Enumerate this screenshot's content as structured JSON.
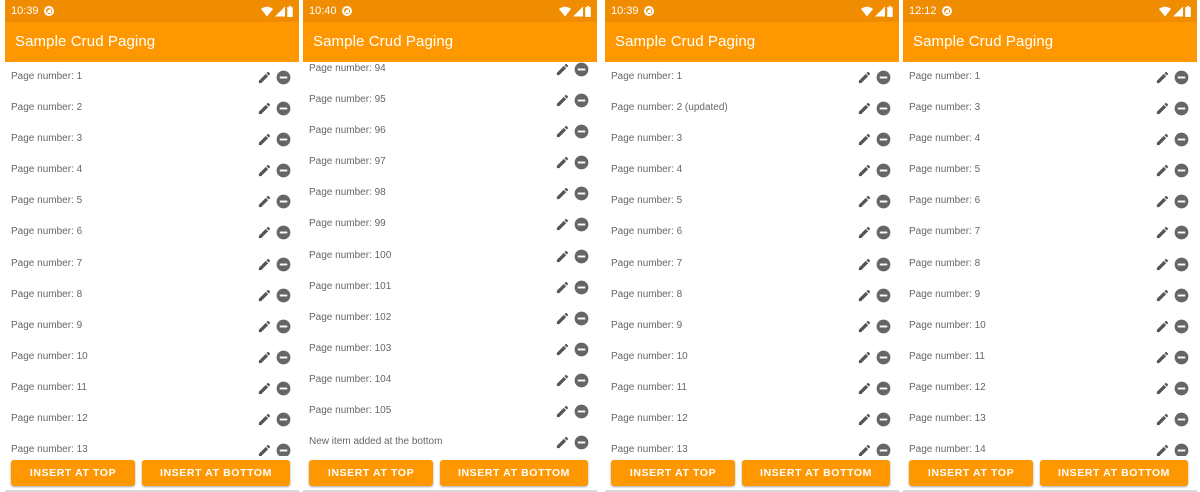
{
  "theme": {
    "accent": "#ff9800",
    "status_bar": "#f08c00",
    "icon_color": "#666666"
  },
  "icons": {
    "edit": "pencil-icon",
    "remove": "minus-circle-icon"
  },
  "screens": [
    {
      "status_time": "10:39",
      "title": "Sample Crud Paging",
      "items": [
        "Page number: 1",
        "Page number: 2",
        "Page number: 3",
        "Page number: 4",
        "Page number: 5",
        "Page number: 6",
        "Page number: 7",
        "Page number: 8",
        "Page number: 9",
        "Page number: 10",
        "Page number: 11",
        "Page number: 12",
        "Page number: 13"
      ],
      "buttons": {
        "insert_top": "Insert at top",
        "insert_bottom": "Insert at bottom"
      }
    },
    {
      "status_time": "10:40",
      "title": "Sample Crud Paging",
      "items": [
        "Page number: 94",
        "Page number: 95",
        "Page number: 96",
        "Page number: 97",
        "Page number: 98",
        "Page number: 99",
        "Page number: 100",
        "Page number: 101",
        "Page number: 102",
        "Page number: 103",
        "Page number: 104",
        "Page number: 105",
        "New item added at the bottom"
      ],
      "buttons": {
        "insert_top": "Insert at top",
        "insert_bottom": "Insert at bottom"
      }
    },
    {
      "status_time": "10:39",
      "title": "Sample Crud Paging",
      "items": [
        "Page number: 1",
        "Page number: 2 (updated)",
        "Page number: 3",
        "Page number: 4",
        "Page number: 5",
        "Page number: 6",
        "Page number: 7",
        "Page number: 8",
        "Page number: 9",
        "Page number: 10",
        "Page number: 11",
        "Page number: 12",
        "Page number: 13"
      ],
      "buttons": {
        "insert_top": "Insert at top",
        "insert_bottom": "Insert at bottom"
      }
    },
    {
      "status_time": "12:12",
      "title": "Sample Crud Paging",
      "items": [
        "Page number: 1",
        "Page number: 3",
        "Page number: 4",
        "Page number: 5",
        "Page number: 6",
        "Page number: 7",
        "Page number: 8",
        "Page number: 9",
        "Page number: 10",
        "Page number: 11",
        "Page number: 12",
        "Page number: 13",
        "Page number: 14"
      ],
      "buttons": {
        "insert_top": "Insert at top",
        "insert_bottom": "Insert at bottom"
      }
    }
  ]
}
